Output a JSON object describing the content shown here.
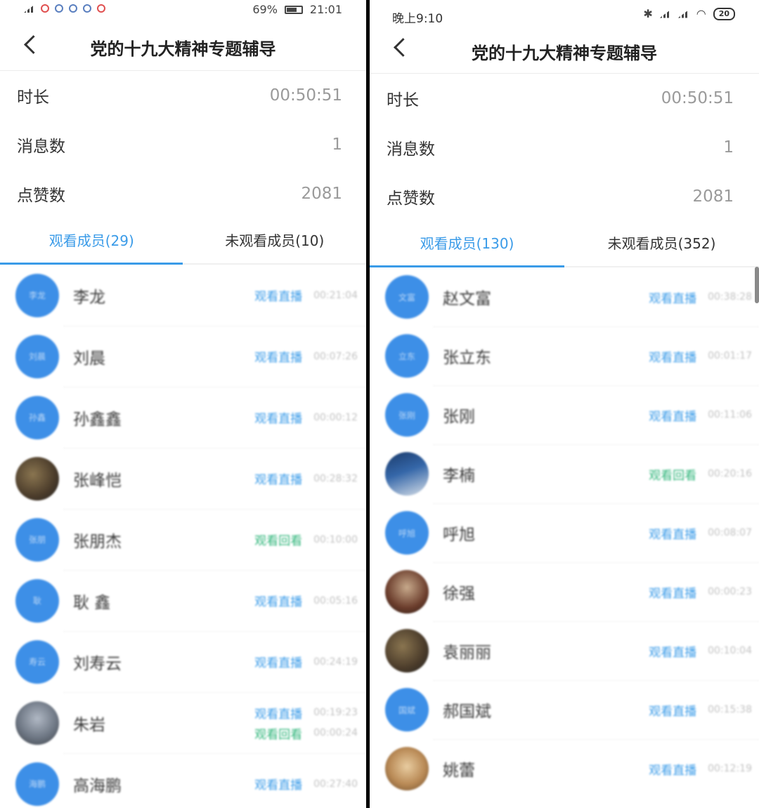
{
  "left": {
    "status": {
      "icons": [
        "signal-4g-icon",
        "car-icon",
        "app-icon",
        "circle-icon",
        "chrome-icon",
        "record-icon"
      ],
      "signal": "4G",
      "battery": "69%",
      "time": "21:01"
    },
    "title": "党的十九大精神专题辅导",
    "stats": [
      {
        "key": "时长",
        "value": "00:50:51"
      },
      {
        "key": "消息数",
        "value": "1"
      },
      {
        "key": "点赞数",
        "value": "2081"
      }
    ],
    "tabs": [
      {
        "label": "观看成员(29)",
        "active": true
      },
      {
        "label": "未观看成员(10)",
        "active": false
      }
    ],
    "members": [
      {
        "avatar_text": "李龙",
        "name": "李龙",
        "acts": [
          {
            "label": "观看直播",
            "time": "00:21:04",
            "type": "live"
          }
        ]
      },
      {
        "avatar_text": "刘晨",
        "name": "刘晨",
        "acts": [
          {
            "label": "观看直播",
            "time": "00:07:26",
            "type": "live"
          }
        ]
      },
      {
        "avatar_text": "孙鑫",
        "name": "孙鑫鑫",
        "acts": [
          {
            "label": "观看直播",
            "time": "00:00:12",
            "type": "live"
          }
        ]
      },
      {
        "avatar_text": "",
        "name": "张峰恺",
        "photo": "photo",
        "acts": [
          {
            "label": "观看直播",
            "time": "00:28:32",
            "type": "live"
          }
        ]
      },
      {
        "avatar_text": "张朋",
        "name": "张朋杰",
        "acts": [
          {
            "label": "观看回看",
            "time": "00:10:00",
            "type": "replay"
          }
        ]
      },
      {
        "avatar_text": "耿",
        "name": "耿 鑫",
        "acts": [
          {
            "label": "观看直播",
            "time": "00:05:16",
            "type": "live"
          }
        ]
      },
      {
        "avatar_text": "寿云",
        "name": "刘寿云",
        "acts": [
          {
            "label": "观看直播",
            "time": "00:24:19",
            "type": "live"
          }
        ]
      },
      {
        "avatar_text": "",
        "name": "朱岩",
        "photo": "photo2",
        "acts": [
          {
            "label": "观看直播",
            "time": "00:19:23",
            "type": "live"
          },
          {
            "label": "观看回看",
            "time": "00:00:24",
            "type": "replay"
          }
        ]
      },
      {
        "avatar_text": "海鹏",
        "name": "高海鹏",
        "acts": [
          {
            "label": "观看直播",
            "time": "00:27:40",
            "type": "live"
          }
        ]
      }
    ]
  },
  "right": {
    "status": {
      "time": "晚上9:10",
      "battery": "20"
    },
    "title": "党的十九大精神专题辅导",
    "stats": [
      {
        "key": "时长",
        "value": "00:50:51"
      },
      {
        "key": "消息数",
        "value": "1"
      },
      {
        "key": "点赞数",
        "value": "2081"
      }
    ],
    "tabs": [
      {
        "label": "观看成员(130)",
        "active": true
      },
      {
        "label": "未观看成员(352)",
        "active": false
      }
    ],
    "members": [
      {
        "avatar_text": "文富",
        "name": "赵文富",
        "acts": [
          {
            "label": "观看直播",
            "time": "00:38:28",
            "type": "live"
          }
        ]
      },
      {
        "avatar_text": "立东",
        "name": "张立东",
        "acts": [
          {
            "label": "观看直播",
            "time": "00:01:17",
            "type": "live"
          }
        ]
      },
      {
        "avatar_text": "张刚",
        "name": "张刚",
        "acts": [
          {
            "label": "观看直播",
            "time": "00:11:06",
            "type": "live"
          }
        ]
      },
      {
        "avatar_text": "",
        "name": "李楠",
        "photo": "photo3",
        "acts": [
          {
            "label": "观看回看",
            "time": "00:20:16",
            "type": "replay"
          }
        ]
      },
      {
        "avatar_text": "呼旭",
        "name": "呼旭",
        "acts": [
          {
            "label": "观看直播",
            "time": "00:08:07",
            "type": "live"
          }
        ]
      },
      {
        "avatar_text": "",
        "name": "徐强",
        "photo": "photo4",
        "acts": [
          {
            "label": "观看直播",
            "time": "00:00:23",
            "type": "live"
          }
        ]
      },
      {
        "avatar_text": "",
        "name": "袁丽丽",
        "photo": "photo",
        "acts": [
          {
            "label": "观看直播",
            "time": "00:10:04",
            "type": "live"
          }
        ]
      },
      {
        "avatar_text": "国斌",
        "name": "郝国斌",
        "acts": [
          {
            "label": "观看直播",
            "time": "00:15:38",
            "type": "live"
          }
        ]
      },
      {
        "avatar_text": "",
        "name": "姚蕾",
        "photo": "photo5",
        "acts": [
          {
            "label": "观看直播",
            "time": "00:12:19",
            "type": "live"
          }
        ]
      }
    ]
  }
}
